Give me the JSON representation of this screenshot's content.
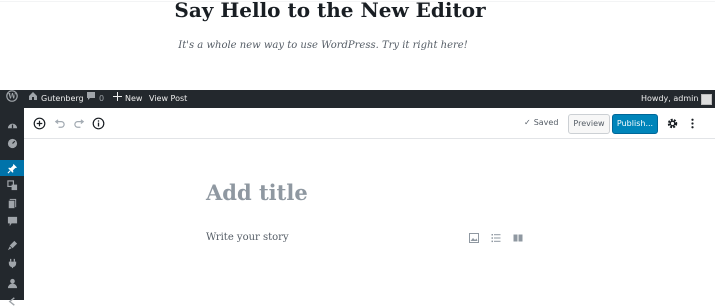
{
  "hero": {
    "title": "Say Hello to the New Editor",
    "subtitle": "It's a whole new way to use WordPress. Try it right here!"
  },
  "adminbar": {
    "site_name": "Gutenberg",
    "comments_count": "0",
    "new_label": "New",
    "view_post_label": "View Post",
    "howdy": "Howdy, admin"
  },
  "sidebar": {
    "items": [
      {
        "icon": "dashboard-icon"
      },
      {
        "icon": "gauge-icon"
      },
      {
        "icon": "pin-icon",
        "active": true
      },
      {
        "icon": "media-icon"
      },
      {
        "icon": "pages-icon"
      },
      {
        "icon": "comments-icon"
      },
      {
        "icon": "appearance-icon"
      },
      {
        "icon": "plugins-icon"
      },
      {
        "icon": "users-icon"
      }
    ]
  },
  "toolbar": {
    "saved_label": "Saved",
    "preview_label": "Preview",
    "publish_label": "Publish..."
  },
  "editor": {
    "title_placeholder": "Add title",
    "body_placeholder": "Write your story"
  },
  "colors": {
    "adminbar": "#23282d",
    "accent": "#0073aa",
    "publish": "#0085ba"
  }
}
